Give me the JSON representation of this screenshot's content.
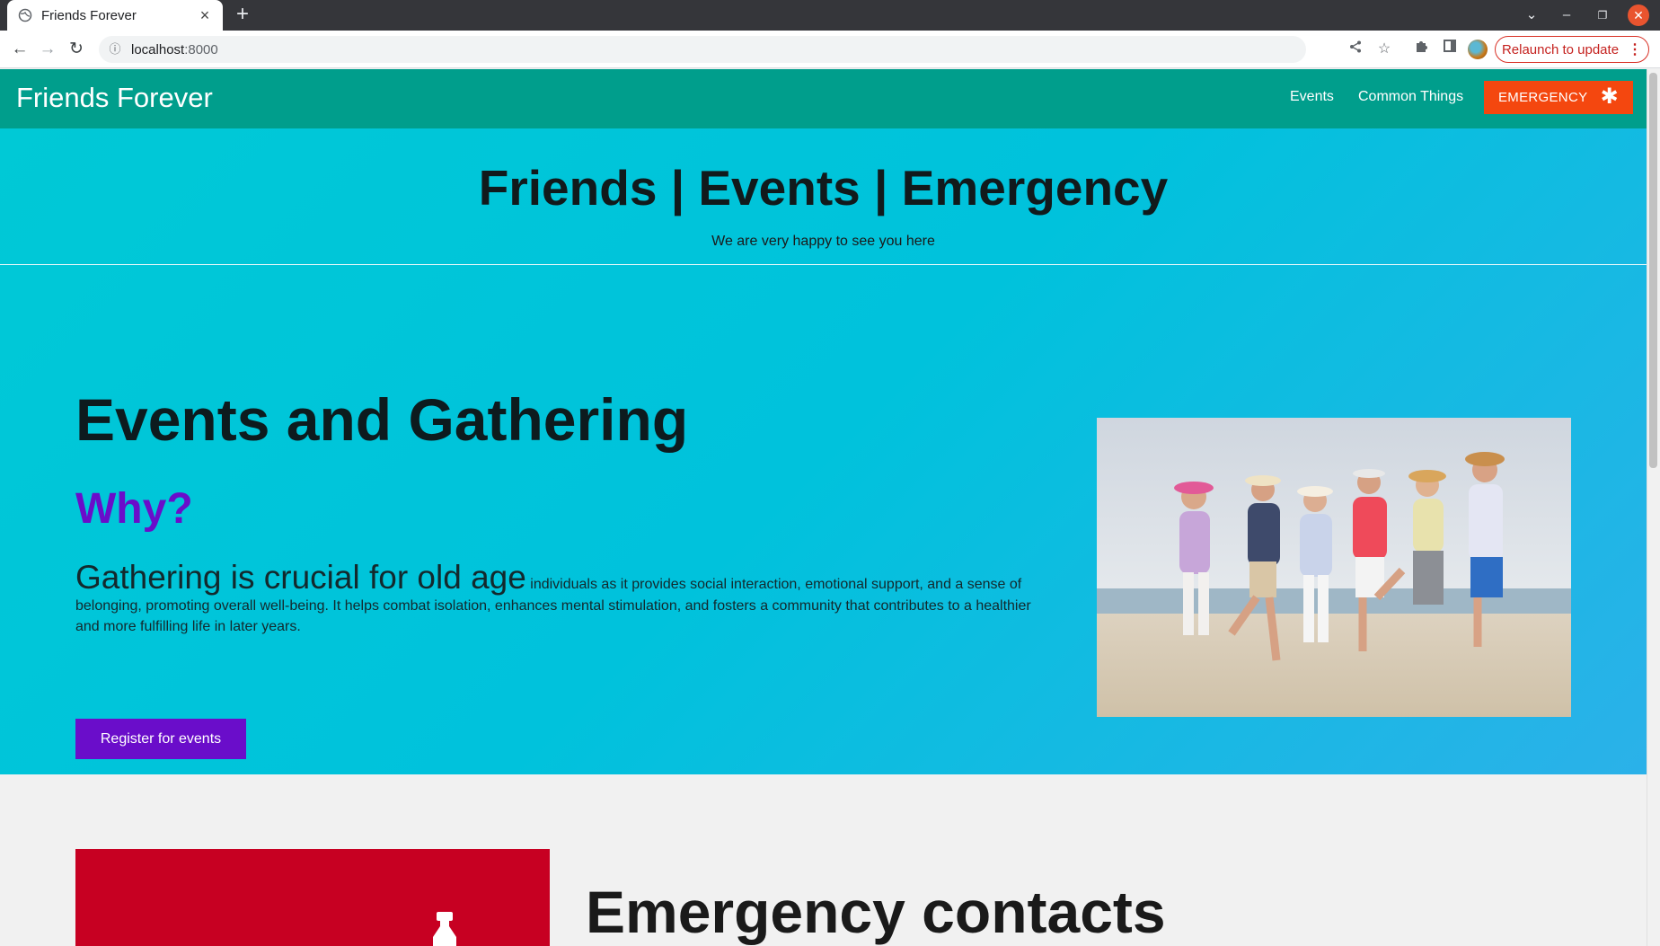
{
  "browser": {
    "tab_title": "Friends Forever",
    "url_host": "localhost",
    "url_port": ":8000",
    "relaunch_label": "Relaunch to update"
  },
  "nav": {
    "brand": "Friends Forever",
    "links": [
      "Events",
      "Common Things"
    ],
    "emergency_label": "EMERGENCY",
    "color": "#009e8c",
    "emergency_color": "#f4470f"
  },
  "hero": {
    "title": "Friends | Events | Emergency",
    "subtitle": "We are very happy to see you here"
  },
  "events": {
    "heading": "Events and Gathering",
    "why": "Why?",
    "lead": "Gathering is crucial for old age",
    "body": "individuals as it provides social interaction, emotional support, and a sense of belonging, promoting overall well-being. It helps combat isolation, enhances mental stimulation, and fosters a community that contributes to a healthier and more fulfilling life in later years.",
    "register_label": "Register for events",
    "accent_color": "#6a0dca"
  },
  "emergency": {
    "heading": "Emergency contacts",
    "card_color": "#c70022"
  },
  "icons": [
    "globe-icon",
    "close-icon",
    "plus-icon",
    "back-icon",
    "forward-icon",
    "reload-icon",
    "info-icon",
    "share-icon",
    "star-icon",
    "puzzle-icon",
    "sidepanel-icon",
    "asterisk-icon",
    "bottle-icon"
  ]
}
